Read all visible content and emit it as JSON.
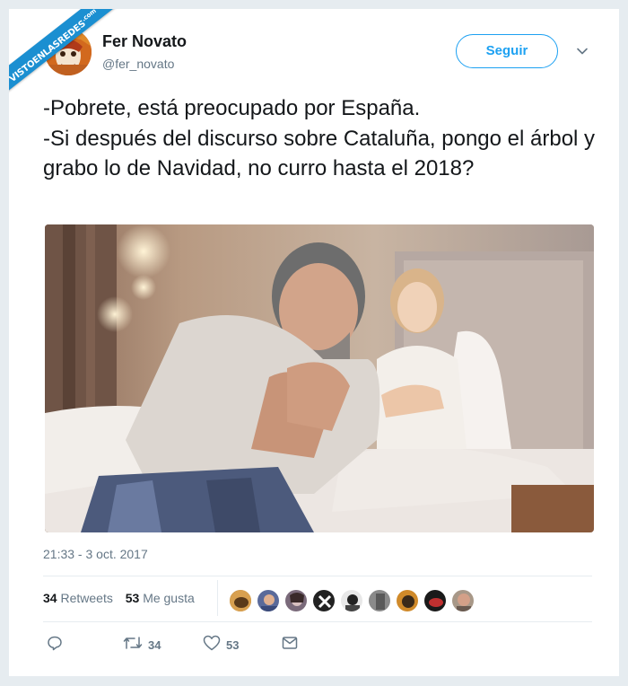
{
  "watermark": {
    "text": "VISTOENLASREDES",
    "suffix": ".com"
  },
  "tweet": {
    "author_name": "Fer Novato",
    "author_handle": "@fer_novato",
    "follow_label": "Seguir",
    "text": "-Pobrete, está preocupado por España.\n-Si después del discurso sobre Cataluña, pongo el árbol y grabo lo de Navidad, no curro hasta el 2018?",
    "timestamp": "21:33 - 3 oct. 2017",
    "retweets_count": "34",
    "retweets_label": "Retweets",
    "likes_count": "53",
    "likes_label": "Me gusta",
    "likers": [
      "liker-1",
      "liker-2",
      "liker-3",
      "liker-4",
      "liker-5",
      "liker-6",
      "liker-7",
      "liker-8",
      "liker-9"
    ],
    "actions": {
      "reply_icon": "reply-icon",
      "retweet_icon": "retweet-icon",
      "retweet_count": "34",
      "like_icon": "heart-icon",
      "like_count": "53",
      "dm_icon": "envelope-icon"
    }
  },
  "colors": {
    "accent": "#1da1f2",
    "ribbon": "#1b8fd1",
    "muted": "#657786",
    "text": "#14171a"
  }
}
